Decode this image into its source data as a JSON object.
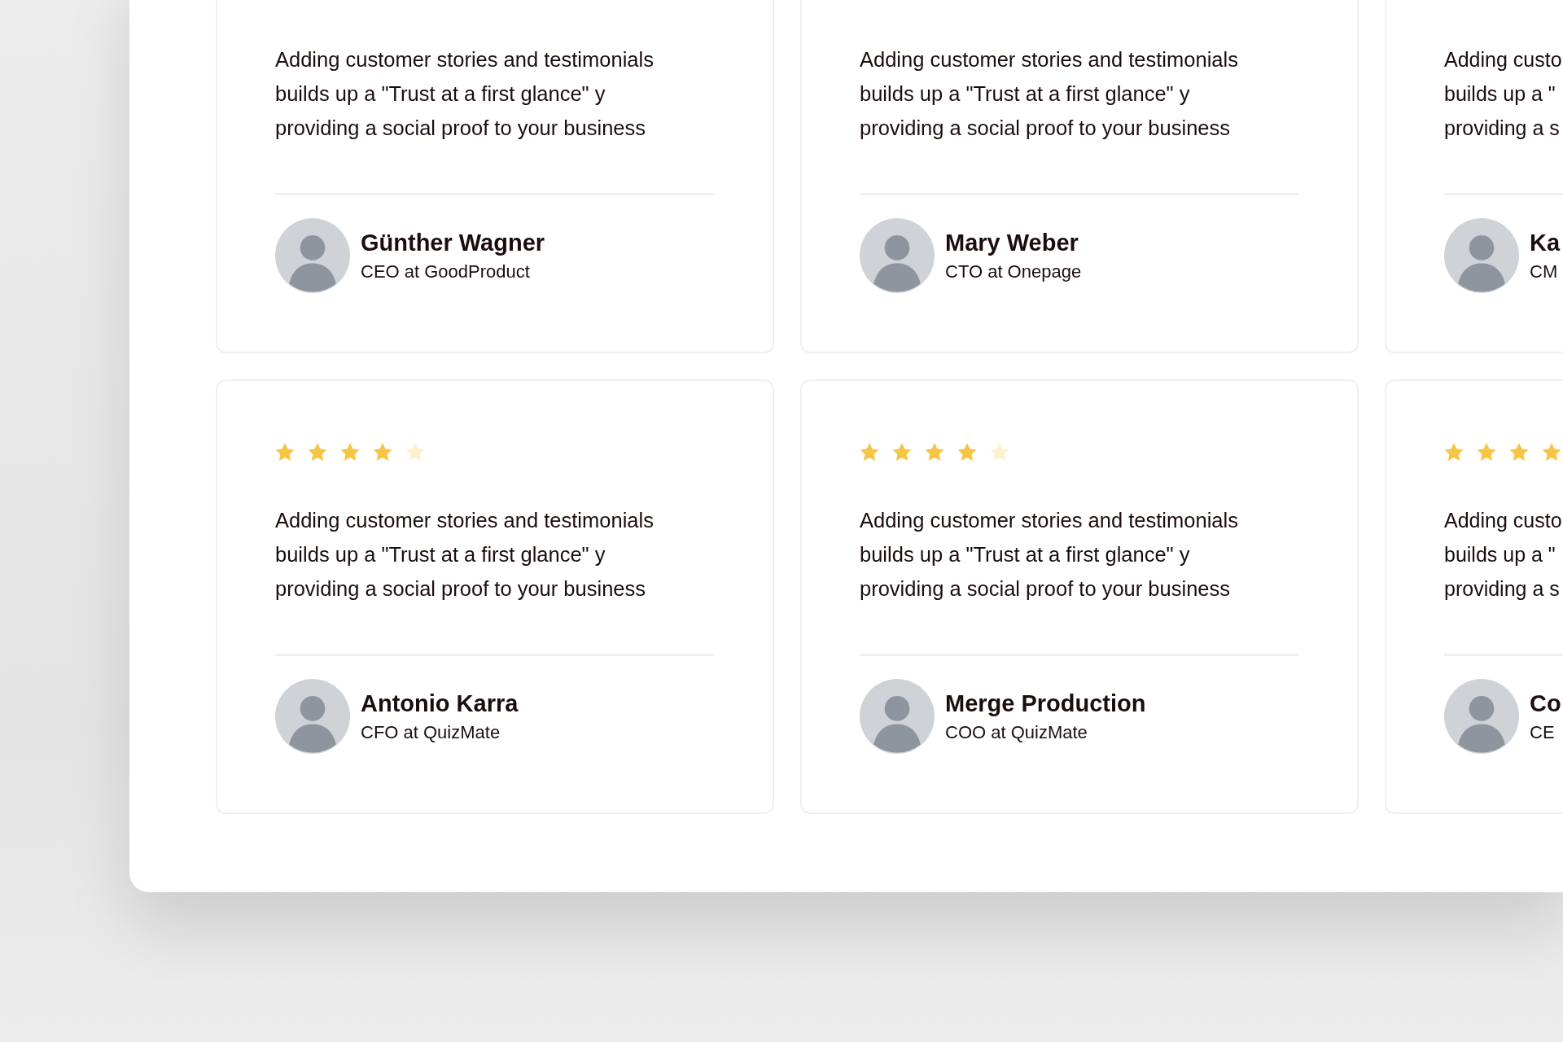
{
  "testimonials": [
    {
      "text": "Adding customer stories and testimonials builds up a \"Trust at a first glance\" y providing a social proof to your business",
      "name": "Günther Wagner",
      "role": "CEO at GoodProduct"
    },
    {
      "text": "Adding customer stories and testimonials builds up a \"Trust at a first glance\" y providing a social proof to your business",
      "name": "Mary Weber",
      "role": "CTO at Onepage"
    },
    {
      "lines": [
        "Adding custo",
        "builds up a \"",
        "providing a s"
      ],
      "name": "Ka",
      "role": "CM"
    },
    {
      "stars": 4,
      "text": "Adding customer stories and testimonials builds up a \"Trust at a first glance\" y providing a social proof to your business",
      "name": "Antonio Karra",
      "role": "CFO at QuizMate"
    },
    {
      "stars": 4,
      "text": "Adding customer stories and testimonials builds up a \"Trust at a first glance\" y providing a social proof to your business",
      "name": "Merge Production",
      "role": "COO at QuizMate"
    },
    {
      "stars": 4,
      "lines": [
        "Adding custo",
        "builds up a \"",
        "providing a s"
      ],
      "name": "Co",
      "role": "CE"
    }
  ]
}
